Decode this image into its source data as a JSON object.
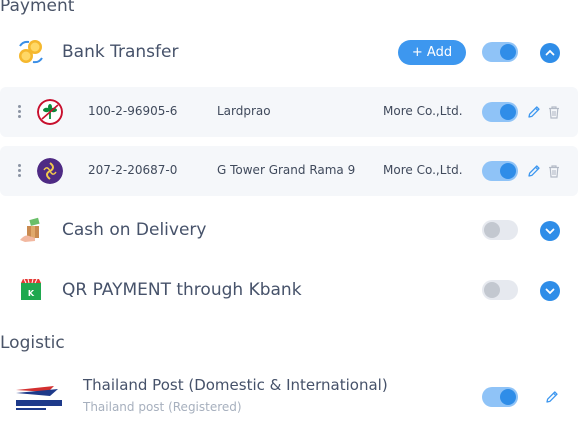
{
  "sections": {
    "payment": "Payment",
    "logistic": "Logistic"
  },
  "bank_transfer": {
    "label": "Bank Transfer",
    "add_label": "+ Add",
    "enabled": true
  },
  "accounts": [
    {
      "number": "100-2-96905-6",
      "branch": "Lardprao",
      "name": "More Co.,Ltd.",
      "enabled": true,
      "logo_color": "#c8102e"
    },
    {
      "number": "207-2-20687-0",
      "branch": "G Tower Grand Rama 9",
      "name": "More Co.,Ltd.",
      "enabled": true,
      "logo_color": "#4e2a84"
    }
  ],
  "cod": {
    "label": "Cash on Delivery",
    "enabled": false
  },
  "qr": {
    "label": "QR PAYMENT through Kbank",
    "enabled": false
  },
  "logistics": [
    {
      "name": "Thailand Post (Domestic & International)",
      "subtitle": "Thailand post (Registered)",
      "enabled": true
    }
  ],
  "colors": {
    "accent": "#2f8de8",
    "toggle_on_track": "#8fc3f7",
    "row_bg": "#f5f7fa"
  }
}
